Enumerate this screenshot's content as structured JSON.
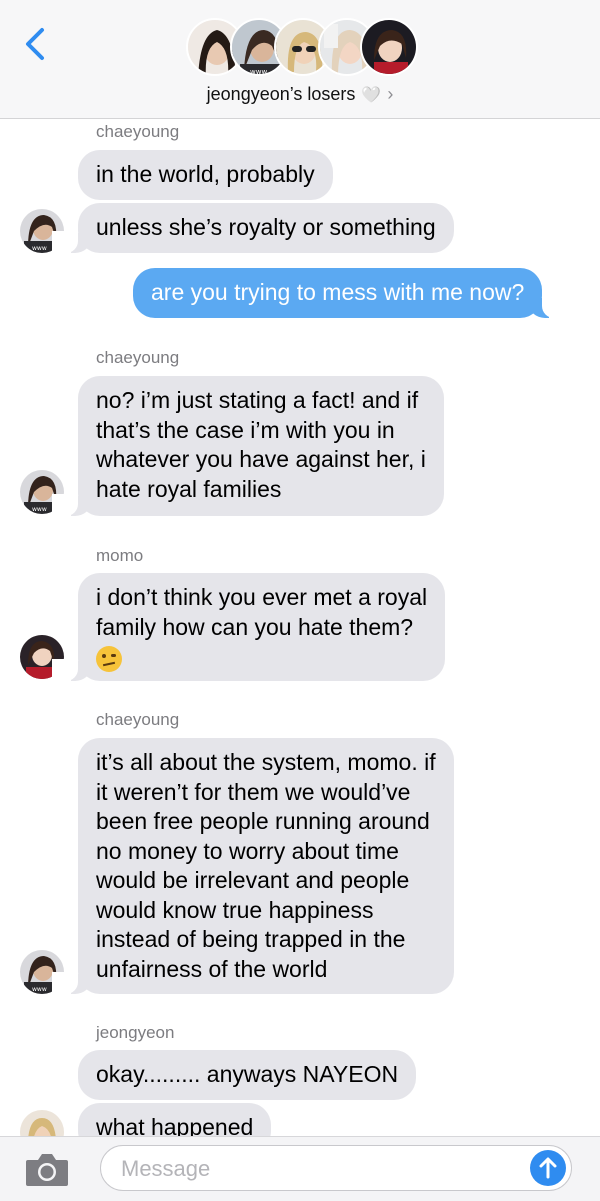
{
  "header": {
    "group_name": "jeongyeon’s losers",
    "heart": "🤍",
    "chevron": "›"
  },
  "colors": {
    "incoming_bubble": "#e5e5ea",
    "outgoing_bubble": "#5ba9f2",
    "accent": "#2f8cf0"
  },
  "messages": [
    {
      "sender": "chaeyoung"
    },
    {
      "text": "in the world, probably"
    },
    {
      "text": "unless she’s royalty or something"
    },
    {
      "text": "are you trying to mess with me now?"
    },
    {
      "sender": "chaeyoung"
    },
    {
      "lines": [
        "no? i’m just stating a fact! and if",
        "that’s the case i’m with you in",
        "whatever you have against her, i",
        "hate royal families"
      ]
    },
    {
      "sender": "momo"
    },
    {
      "lines": [
        "i don’t think you ever met a royal",
        "family how can you hate them?"
      ],
      "emoji": "raised-eyebrow-emoji"
    },
    {
      "sender": "chaeyoung"
    },
    {
      "lines": [
        "it’s all about the system, momo. if",
        "it weren’t for them we would’ve",
        "been free people running around",
        "no money to worry about time",
        "would be irrelevant and people",
        "would know true happiness",
        "instead of being trapped in the",
        "unfairness of the world"
      ]
    },
    {
      "sender": "jeongyeon"
    },
    {
      "text": "okay......... anyways NAYEON"
    },
    {
      "text": "what happened"
    }
  ],
  "input": {
    "placeholder": "Message"
  },
  "icons": {
    "back": "chevron-left-icon",
    "camera": "camera-icon",
    "send": "arrow-up-icon"
  }
}
